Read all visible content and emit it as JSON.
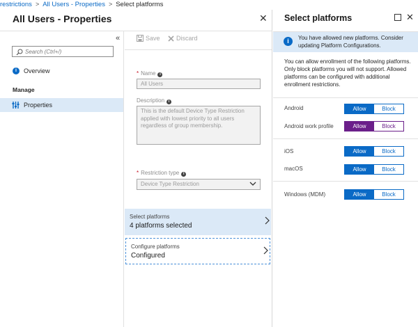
{
  "breadcrumb": {
    "items": [
      "restrictions",
      "All Users - Properties"
    ],
    "current": "Select platforms",
    "separator": ">"
  },
  "left_blade": {
    "title": "All Users - Properties",
    "close_label": "✕",
    "collapse_label": "«",
    "search_placeholder": "Search (Ctrl+/)",
    "nav_overview": "Overview",
    "nav_section": "Manage",
    "nav_properties": "Properties",
    "toolbar": {
      "save_label": "Save",
      "discard_label": "Discard"
    },
    "form": {
      "name_label": "Name",
      "name_value": "All Users",
      "description_label": "Description",
      "description_value": "This is the default Device Type Restriction applied with lowest priority to all users regardless of group membership.",
      "restriction_type_label": "Restriction type",
      "restriction_type_value": "Device Type Restriction"
    },
    "select_platforms": {
      "title": "Select platforms",
      "value": "4 platforms selected"
    },
    "configure_platforms": {
      "title": "Configure platforms",
      "value": "Configured"
    }
  },
  "right_blade": {
    "title": "Select platforms",
    "banner_text": "You have allowed new platforms. Consider updating Platform Configurations.",
    "description": "You can allow enrollment of the following platforms. Only block platforms you will not support. Allowed platforms can be configured with additional enrollment restrictions.",
    "allow_label": "Allow",
    "block_label": "Block",
    "platforms": [
      {
        "name": "Android",
        "selected": "Allow"
      },
      {
        "name": "Android work profile",
        "selected": "Allow"
      },
      {
        "name": "iOS",
        "selected": "Allow"
      },
      {
        "name": "macOS",
        "selected": "Allow"
      },
      {
        "name": "Windows (MDM)",
        "selected": "Allow"
      }
    ]
  },
  "colors": {
    "accent": "#0a6ac6",
    "selected_bg": "#dbe9f7",
    "purple_toggle": "#6b1f8a",
    "required": "#c50f1f"
  },
  "icons": {
    "search": "search-icon",
    "info": "info-icon",
    "properties": "properties-icon",
    "save": "save-icon",
    "discard": "discard-icon",
    "chevron_down": "chevron-down-icon",
    "chevron_right": "chevron-right-icon",
    "maximize": "maximize-icon",
    "close": "close-icon"
  }
}
